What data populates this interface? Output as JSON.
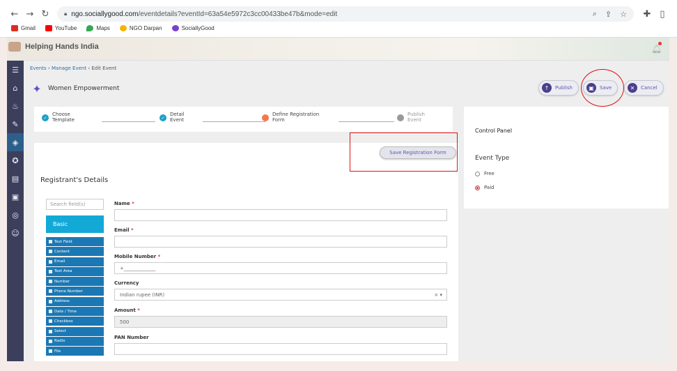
{
  "browser": {
    "url_host": "ngo.sociallygood.com",
    "url_path": "/eventdetails?eventId=63a54e5972c3cc00433be47b&mode=edit",
    "bookmarks": [
      {
        "label": "Gmail",
        "color": "#d93025"
      },
      {
        "label": "YouTube",
        "color": "#ff0000"
      },
      {
        "label": "Maps",
        "color": "#34a853"
      },
      {
        "label": "NGO Darpan",
        "color": "#f4b400"
      },
      {
        "label": "SociallyGood",
        "color": "#7b3fd1"
      }
    ]
  },
  "app": {
    "brand": "Helping Hands India",
    "nav_icons": [
      "menu-icon",
      "home-icon",
      "donation-icon",
      "campaign-icon",
      "event-icon",
      "volunteer-icon",
      "member-icon",
      "ngo-icon",
      "csr-icon",
      "people-icon"
    ]
  },
  "breadcrumb": {
    "events": "Events",
    "manage": "Manage Event",
    "current": "Edit Event",
    "sep": "‹"
  },
  "event": {
    "title": "Women Empowerment"
  },
  "actions": {
    "publish": "Publish",
    "save": "Save",
    "cancel": "Cancel"
  },
  "steps": [
    {
      "line1": "Choose",
      "line2": "Template",
      "status": "done"
    },
    {
      "line1": "Detail",
      "line2": "Event",
      "status": "done"
    },
    {
      "line1": "Define Registration",
      "line2": "Form",
      "status": "current"
    },
    {
      "line1": "Publish",
      "line2": "Event",
      "status": "pending"
    }
  ],
  "form": {
    "save_reg": "Save Registration Form",
    "heading": "Registrant's Details",
    "search_placeholder": "Search field(s)",
    "basic": "Basic",
    "field_types": [
      "Text Field",
      "Content",
      "Email",
      "Text Area",
      "Number",
      "Phone Number",
      "Address",
      "Date / Time",
      "Checkbox",
      "Select",
      "Radio",
      "File"
    ],
    "fields": {
      "name": {
        "label": "Name",
        "req": "*"
      },
      "email": {
        "label": "Email",
        "req": "*"
      },
      "mobile": {
        "label": "Mobile Number",
        "req": "*",
        "placeholder": "+_____________"
      },
      "currency": {
        "label": "Currency",
        "value": "Indian rupee (INR)",
        "clear": "×",
        "caret": "▾"
      },
      "amount": {
        "label": "Amount",
        "req": "*",
        "value": "500"
      },
      "pan": {
        "label": "PAN Number"
      }
    }
  },
  "control_panel": {
    "title": "Control Panel",
    "event_type": "Event Type",
    "free": "Free",
    "paid": "Paid"
  }
}
